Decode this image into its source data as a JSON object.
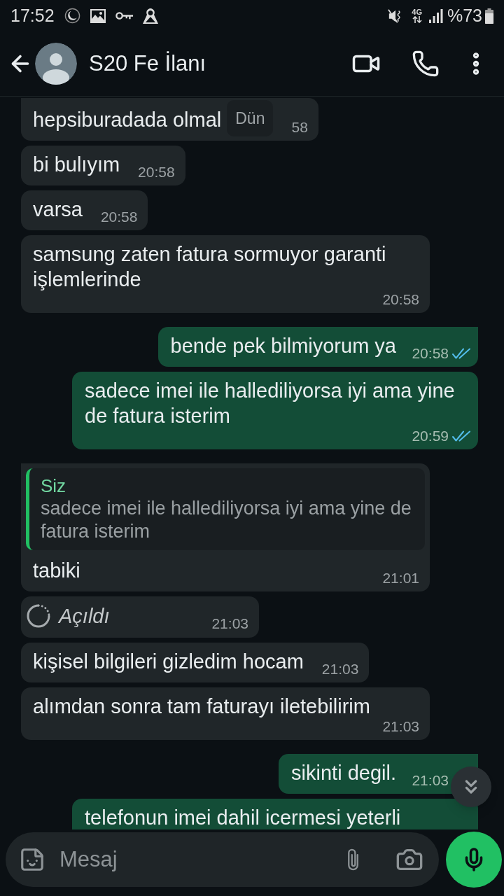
{
  "status_bar": {
    "time": "17:52",
    "network": "4G",
    "battery": "%73"
  },
  "header": {
    "title": "S20 Fe İlanı"
  },
  "date_chip": "Dün",
  "messages": [
    {
      "outgoing": false,
      "tail": true,
      "kind": "text",
      "text": "hepsiburadada olmal",
      "time": "58"
    },
    {
      "outgoing": false,
      "tail": false,
      "kind": "text",
      "text": "bi bulıyım",
      "time": "20:58"
    },
    {
      "outgoing": false,
      "tail": false,
      "kind": "text",
      "text": "varsa",
      "time": "20:58"
    },
    {
      "outgoing": false,
      "tail": false,
      "kind": "text",
      "text": "samsung zaten fatura sormuyor garanti işlemlerinde",
      "time": "20:58"
    },
    {
      "outgoing": true,
      "tail": true,
      "kind": "text",
      "text": "bende pek bilmiyorum ya",
      "time": "20:58",
      "read": true
    },
    {
      "outgoing": true,
      "tail": false,
      "kind": "text",
      "text": "sadece imei ile hallediliyorsa iyi ama yine de fatura isterim",
      "time": "20:59",
      "read": true
    },
    {
      "outgoing": false,
      "tail": true,
      "kind": "reply",
      "quote": {
        "author": "Siz",
        "text": "sadece imei ile hallediliyorsa iyi ama yine de fatura isterim"
      },
      "text": "tabiki",
      "time": "21:01"
    },
    {
      "outgoing": false,
      "tail": false,
      "kind": "view_once",
      "text": "Açıldı",
      "time": "21:03"
    },
    {
      "outgoing": false,
      "tail": false,
      "kind": "text",
      "text": "kişisel bilgileri gizledim hocam",
      "time": "21:03"
    },
    {
      "outgoing": false,
      "tail": false,
      "kind": "text",
      "text": "alımdan sonra tam faturayı iletebilirim",
      "time": "21:03"
    },
    {
      "outgoing": true,
      "tail": true,
      "kind": "text",
      "text": "sikinti degil.",
      "time": "21:03"
    },
    {
      "outgoing": true,
      "tail": false,
      "kind": "text",
      "text": "telefonun imei dahil icermesi yeterli"
    }
  ],
  "composer": {
    "placeholder": "Mesaj"
  }
}
